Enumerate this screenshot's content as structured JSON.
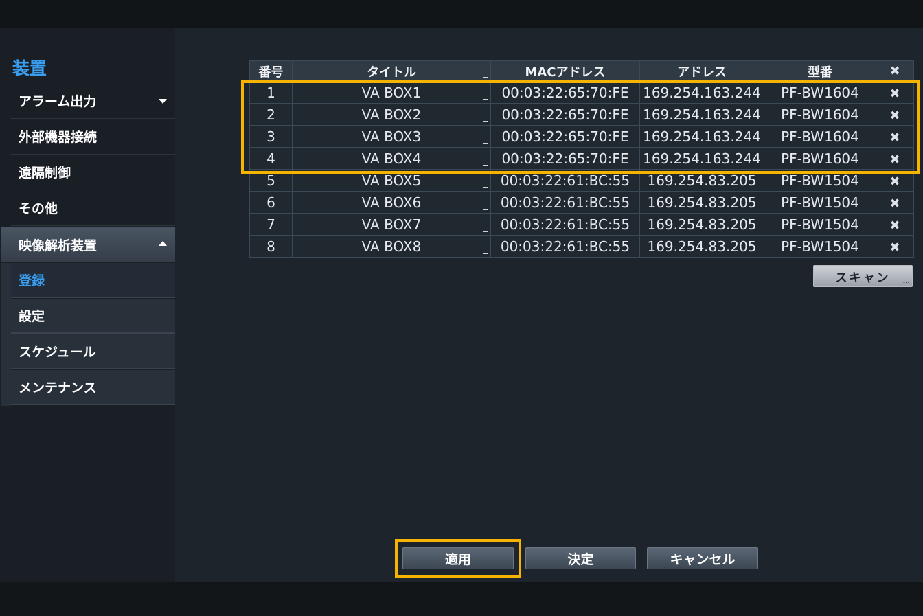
{
  "sidebar": {
    "title": "装置",
    "items": [
      {
        "label": "アラーム出力"
      },
      {
        "label": "外部機器接続"
      },
      {
        "label": "遠隔制御"
      },
      {
        "label": "その他"
      },
      {
        "label": "映像解析装置"
      }
    ],
    "subitems": [
      {
        "label": "登録",
        "active": true
      },
      {
        "label": "設定"
      },
      {
        "label": "スケジュール"
      },
      {
        "label": "メンテナンス"
      }
    ]
  },
  "table": {
    "headers": {
      "number": "番号",
      "title": "タイトル",
      "mac": "MACアドレス",
      "address": "アドレス",
      "model": "型番",
      "delete_icon": "close-icon"
    },
    "rows": [
      {
        "number": "1",
        "title": "VA BOX1",
        "mac": "00:03:22:65:70:FE",
        "address": "169.254.163.244",
        "model": "PF-BW1604"
      },
      {
        "number": "2",
        "title": "VA BOX2",
        "mac": "00:03:22:65:70:FE",
        "address": "169.254.163.244",
        "model": "PF-BW1604"
      },
      {
        "number": "3",
        "title": "VA BOX3",
        "mac": "00:03:22:65:70:FE",
        "address": "169.254.163.244",
        "model": "PF-BW1604"
      },
      {
        "number": "4",
        "title": "VA BOX4",
        "mac": "00:03:22:65:70:FE",
        "address": "169.254.163.244",
        "model": "PF-BW1604"
      },
      {
        "number": "5",
        "title": "VA BOX5",
        "mac": "00:03:22:61:BC:55",
        "address": "169.254.83.205",
        "model": "PF-BW1504"
      },
      {
        "number": "6",
        "title": "VA BOX6",
        "mac": "00:03:22:61:BC:55",
        "address": "169.254.83.205",
        "model": "PF-BW1504"
      },
      {
        "number": "7",
        "title": "VA BOX7",
        "mac": "00:03:22:61:BC:55",
        "address": "169.254.83.205",
        "model": "PF-BW1504"
      },
      {
        "number": "8",
        "title": "VA BOX8",
        "mac": "00:03:22:61:BC:55",
        "address": "169.254.83.205",
        "model": "PF-BW1504"
      }
    ]
  },
  "buttons": {
    "scan": "スキャン",
    "apply": "適用",
    "ok": "決定",
    "cancel": "キャンセル"
  },
  "colors": {
    "accent": "#3a9ef0",
    "highlight": "#f6b400"
  }
}
